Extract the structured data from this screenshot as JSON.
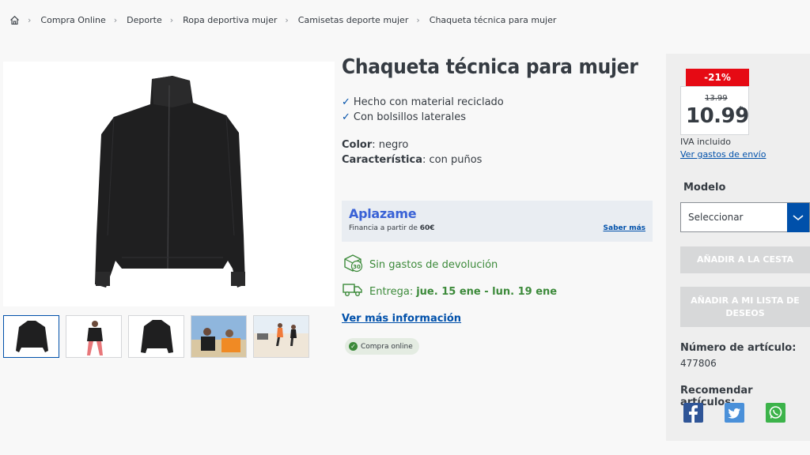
{
  "breadcrumb": {
    "items": [
      "Compra Online",
      "Deporte",
      "Ropa deportiva mujer",
      "Camisetas deporte mujer",
      "Chaqueta técnica para mujer"
    ]
  },
  "product": {
    "title": "Chaqueta técnica para mujer",
    "features": [
      "Hecho con material reciclado",
      "Con bolsillos laterales"
    ],
    "color_label": "Color",
    "color_value": ": negro",
    "feature_label": "Característica",
    "feature_value": ": con puños"
  },
  "aplazame": {
    "logo": "Aplazame",
    "financing_prefix": "Financia a partir de ",
    "financing_amount": "60€",
    "more_link": "Saber más"
  },
  "benefits": {
    "returns": "Sin gastos de devolución",
    "delivery_label": "Entrega: ",
    "delivery_dates": "jue. 15 ene - lun. 19 ene"
  },
  "links": {
    "more_info": "Ver más información"
  },
  "badge": {
    "online": "Compra online"
  },
  "price": {
    "discount": "-21%",
    "old": "13.99",
    "current": "10.99",
    "asterisk": "*",
    "vat": "IVA incluido",
    "shipping_link": "Ver gastos de envío"
  },
  "model": {
    "label": "Modelo",
    "selected": "Seleccionar"
  },
  "buttons": {
    "add_to_cart": "AÑADIR A LA CESTA",
    "wishlist_line1": "AÑADIR A MI LISTA DE",
    "wishlist_line2": "DESEOS"
  },
  "article": {
    "label": "Número de artículo:",
    "number": "477806"
  },
  "recommend": {
    "label": "Recomendar artículos:"
  },
  "colors": {
    "brand_blue": "#0050aa",
    "discount_red": "#e60a14",
    "green": "#3c8a3a",
    "facebook": "#2f5597",
    "twitter": "#4a90d9",
    "whatsapp": "#3cb34a"
  },
  "icons": [
    "home-icon",
    "chevron-right-icon",
    "check-icon",
    "return-30-icon",
    "truck-icon",
    "chevron-down-icon",
    "facebook-icon",
    "twitter-icon",
    "whatsapp-icon"
  ]
}
